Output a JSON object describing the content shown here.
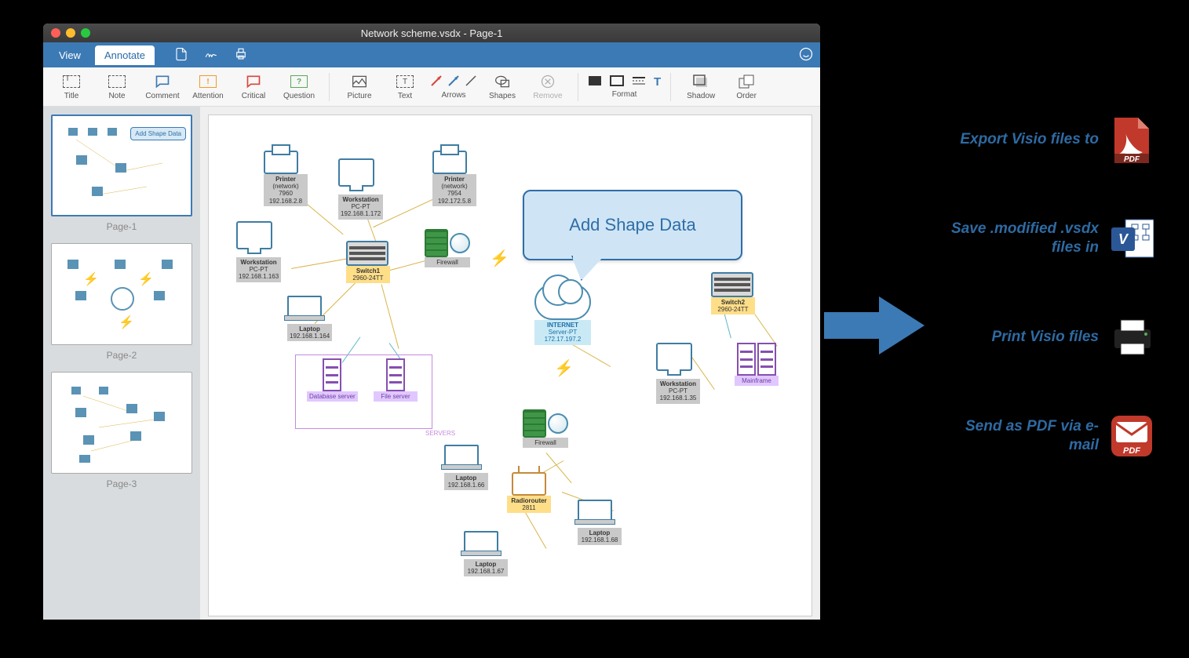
{
  "window": {
    "title": "Network scheme.vsdx - Page-1"
  },
  "tabs": {
    "view": "View",
    "annotate": "Annotate"
  },
  "toolbar": {
    "title": "Title",
    "note": "Note",
    "comment": "Comment",
    "attention": "Attention",
    "critical": "Critical",
    "question": "Question",
    "picture": "Picture",
    "text": "Text",
    "arrows": "Arrows",
    "shapes": "Shapes",
    "remove": "Remove",
    "format": "Format",
    "shadow": "Shadow",
    "order": "Order"
  },
  "pages": [
    "Page-1",
    "Page-2",
    "Page-3"
  ],
  "callout": "Add Shape Data",
  "thumb_callout": "Add Shape Data",
  "servers_group": "SERVERS",
  "nodes": {
    "printer1": {
      "name": "Printer",
      "sub": "(network)",
      "id": "7960",
      "ip": "192.168.2.8"
    },
    "printer2": {
      "name": "Printer",
      "sub": "(network)",
      "id": "7954",
      "ip": "192.172.5.8"
    },
    "ws1": {
      "name": "Workstation",
      "sub": "PC-PT",
      "ip": "192.168.1.172"
    },
    "ws2": {
      "name": "Workstation",
      "sub": "PC-PT",
      "ip": "192.168.1.163"
    },
    "ws3": {
      "name": "Workstation",
      "sub": "PC-PT",
      "ip": "192.168.1.35"
    },
    "switch1": {
      "name": "Switch1",
      "model": "2960-24TT"
    },
    "switch2": {
      "name": "Switch2",
      "model": "2960-24TT"
    },
    "fw1": {
      "name": "Firewall"
    },
    "fw2": {
      "name": "Firewall"
    },
    "laptop1": {
      "name": "Laptop",
      "ip": "192.168.1.164"
    },
    "laptop2": {
      "name": "Laptop",
      "ip": "192.168.1.66"
    },
    "laptop3": {
      "name": "Laptop",
      "ip": "192.168.1.67"
    },
    "laptop4": {
      "name": "Laptop",
      "ip": "192.168.1.68"
    },
    "radiorouter": {
      "name": "Radiorouter",
      "id": "2811"
    },
    "internet": {
      "name": "INTERNET",
      "sub": "Server-PT",
      "ip": "172.17.197.2"
    },
    "dbserver": {
      "name": "Database server"
    },
    "fileserver": {
      "name": "File server"
    },
    "mainframe": {
      "name": "Mainframe"
    }
  },
  "actions": {
    "export": "Export Visio files to",
    "save": "Save .modified .vsdx files in",
    "print": "Print Visio files",
    "send": "Send as PDF via e-mail"
  },
  "icons": {
    "pdf_label": "PDF"
  }
}
